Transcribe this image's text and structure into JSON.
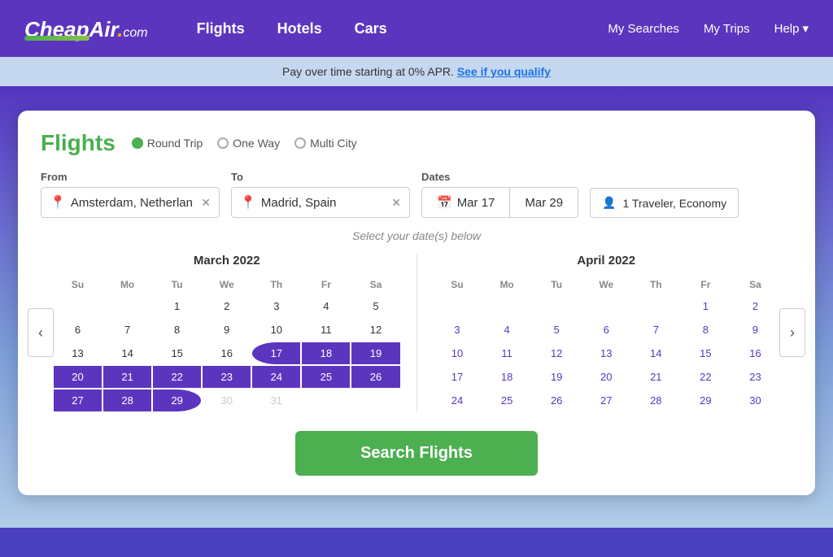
{
  "nav": {
    "logo_text": "CheapAir",
    "logo_com": ".com",
    "links": [
      "Flights",
      "Hotels",
      "Cars"
    ],
    "right_links": [
      "My Searches",
      "My Trips",
      "Help"
    ],
    "help_arrow": "▾"
  },
  "promo": {
    "text": "Pay over time starting at 0% APR.",
    "link_text": "See if you qualify"
  },
  "search": {
    "title": "Flights",
    "trip_types": [
      {
        "label": "Round Trip",
        "active": true
      },
      {
        "label": "One Way",
        "active": false
      },
      {
        "label": "Multi City",
        "active": false
      }
    ],
    "from_label": "From",
    "from_value": "Amsterdam, Netherlands",
    "to_label": "To",
    "to_value": "Madrid, Spain",
    "dates_label": "Dates",
    "date_start": "Mar 17",
    "date_end": "Mar 29",
    "traveler": "1 Traveler, Economy",
    "select_dates_text": "Select your date(s) below",
    "search_btn_label": "Search Flights"
  },
  "calendar": {
    "march": {
      "title": "March 2022",
      "headers": [
        "Su",
        "Mo",
        "Tu",
        "We",
        "Th",
        "Fr",
        "Sa"
      ],
      "weeks": [
        [
          null,
          null,
          1,
          2,
          3,
          4,
          5
        ],
        [
          6,
          7,
          8,
          9,
          10,
          11,
          12
        ],
        [
          13,
          14,
          15,
          16,
          17,
          18,
          19
        ],
        [
          20,
          21,
          22,
          23,
          24,
          25,
          26
        ],
        [
          27,
          28,
          29,
          30,
          31,
          null,
          null
        ]
      ],
      "range_start": 17,
      "range_end": 29,
      "in_range": [
        18,
        19,
        20,
        21,
        22,
        23,
        24,
        25,
        26,
        27,
        28
      ],
      "gray_after": 29
    },
    "april": {
      "title": "April 2022",
      "headers": [
        "Su",
        "Mo",
        "Tu",
        "We",
        "Th",
        "Fr",
        "Sa"
      ],
      "weeks": [
        [
          null,
          null,
          null,
          null,
          null,
          1,
          2
        ],
        [
          3,
          4,
          5,
          6,
          7,
          8,
          9
        ],
        [
          10,
          11,
          12,
          13,
          14,
          15,
          16
        ],
        [
          17,
          18,
          19,
          20,
          21,
          22,
          23
        ],
        [
          24,
          25,
          26,
          27,
          28,
          29,
          30
        ]
      ]
    }
  }
}
